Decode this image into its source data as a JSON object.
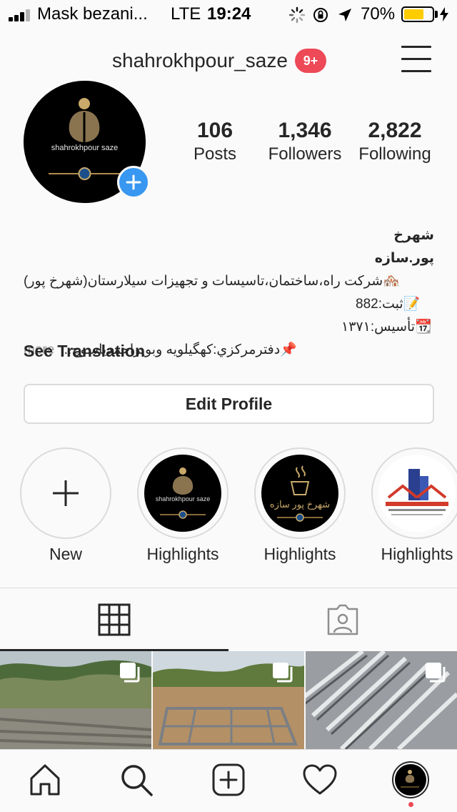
{
  "status_bar": {
    "carrier": "Mask bezani...",
    "network": "LTE",
    "time": "19:24",
    "battery_percent": "70%",
    "battery_level": 0.7,
    "icons": [
      "signal-icon",
      "loading-icon",
      "orientation-lock-icon",
      "location-arrow-icon",
      "battery-icon",
      "charging-bolt-icon"
    ]
  },
  "header": {
    "username": "shahrokhpour_saze",
    "notification_badge": "9+"
  },
  "profile": {
    "avatar_text": "shahrokhpour saze",
    "stats": [
      {
        "value": "106",
        "label": "Posts"
      },
      {
        "value": "1,346",
        "label": "Followers"
      },
      {
        "value": "2,822",
        "label": "Following"
      }
    ]
  },
  "bio": {
    "name": "شهرخ پور.سازه",
    "lines": [
      "🏘️شرکت راه،ساختمان،تاسیسات و تجهیزات سیلارستان(شهرخ پور)",
      "📝ثبت:882",
      "📆تأسیس:۱۳۷۱",
      "📌دفترمرکزي:کهگیلویه وبویراحمدیاسوج..."
    ],
    "more_label": "more",
    "see_translation": "See Translation"
  },
  "edit_profile_label": "Edit Profile",
  "highlights": [
    {
      "label": "New",
      "type": "new"
    },
    {
      "label": "Highlights",
      "img_text": "shahrokhpour saze"
    },
    {
      "label": "Highlights",
      "img_text": "شهرخ پور سازه"
    },
    {
      "label": "Highlights",
      "img_text": ""
    }
  ],
  "tabs": [
    {
      "name": "grid",
      "icon": "grid-icon",
      "active": true
    },
    {
      "name": "tagged",
      "icon": "tagged-person-icon",
      "active": false
    }
  ],
  "colors": {
    "accent_blue": "#3897f0",
    "badge_red": "#ed4956",
    "battery_yellow": "#ffcc00",
    "text": "#262626",
    "border": "#dbdbdb"
  },
  "bottom_nav": [
    "home-icon",
    "search-icon",
    "add-post-icon",
    "heart-icon",
    "profile-avatar"
  ]
}
